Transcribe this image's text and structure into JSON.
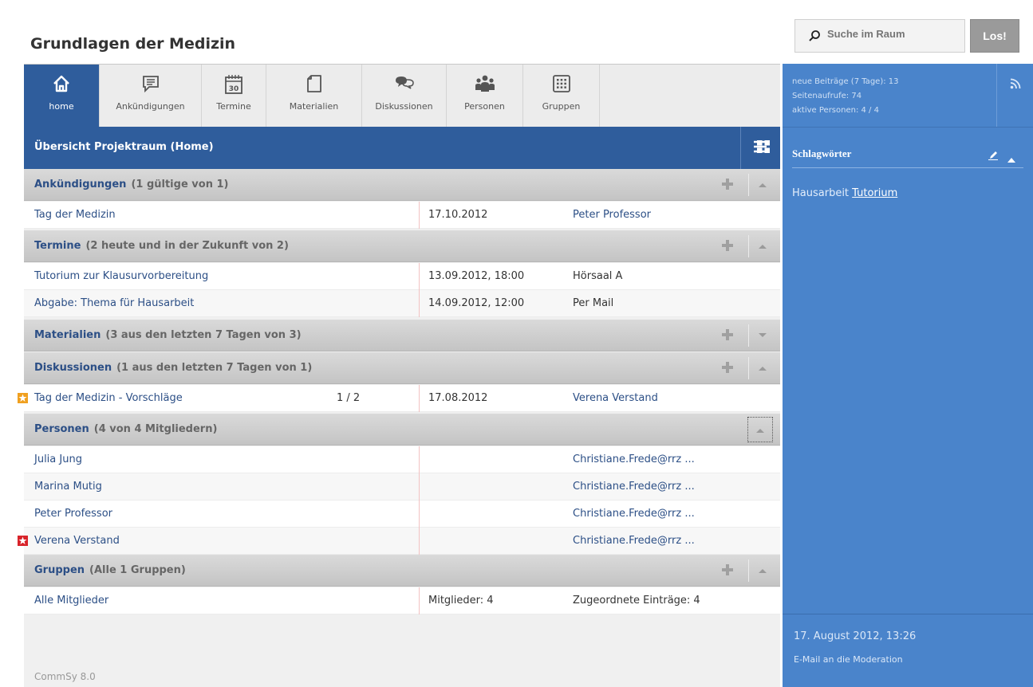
{
  "title": "Grundlagen der Medizin",
  "nav": [
    {
      "label": "home",
      "icon": "home-icon"
    },
    {
      "label": "Ankündigungen",
      "icon": "announcement-icon"
    },
    {
      "label": "Termine",
      "icon": "calendar-icon",
      "icon_text": "30"
    },
    {
      "label": "Materialien",
      "icon": "document-icon"
    },
    {
      "label": "Diskussionen",
      "icon": "discussion-icon"
    },
    {
      "label": "Personen",
      "icon": "people-icon"
    },
    {
      "label": "Gruppen",
      "icon": "groups-grid-icon"
    }
  ],
  "main": {
    "title": "Übersicht Projektraum (Home)",
    "footer": "CommSy 8.0"
  },
  "sections": {
    "ankuendigungen": {
      "title": "Ankündigungen",
      "count": "(1 gültige von 1)"
    },
    "termine": {
      "title": "Termine",
      "count": "(2 heute und in der Zukunft von 2)"
    },
    "materialien": {
      "title": "Materialien",
      "count": "(3 aus den letzten 7 Tagen von 3)"
    },
    "diskussionen": {
      "title": "Diskussionen",
      "count": "(1 aus den letzten 7 Tagen von 1)"
    },
    "personen": {
      "title": "Personen",
      "count": "(4 von 4 Mitgliedern)"
    },
    "gruppen": {
      "title": "Gruppen",
      "count": "(Alle 1 Gruppen)"
    }
  },
  "rows": {
    "ank1": {
      "c1": "Tag der Medizin",
      "c2": "17.10.2012",
      "c3": "Peter Professor"
    },
    "ter1": {
      "c1": "Tutorium zur Klausurvorbereitung",
      "c2": "13.09.2012, 18:00",
      "c3": "Hörsaal A"
    },
    "ter2": {
      "c1": "Abgabe: Thema für Hausarbeit",
      "c2": "14.09.2012, 12:00",
      "c3": "Per Mail"
    },
    "dis1": {
      "c1": "Tag der Medizin - Vorschläge",
      "c1b": "1 / 2",
      "c2": "17.08.2012",
      "c3": "Verena Verstand"
    },
    "per1": {
      "c1": "Julia Jung",
      "c3": "Christiane.Frede@rrz ..."
    },
    "per2": {
      "c1": "Marina Mutig",
      "c3": "Christiane.Frede@rrz ..."
    },
    "per3": {
      "c1": "Peter Professor",
      "c3": "Christiane.Frede@rrz ..."
    },
    "per4": {
      "c1": "Verena Verstand",
      "c3": "Christiane.Frede@rrz ..."
    },
    "gru1": {
      "c1": "Alle Mitglieder",
      "c2": "Mitglieder: 4",
      "c3": "Zugeordnete Einträge: 4"
    }
  },
  "search": {
    "placeholder": "Suche im Raum",
    "button": "Los!"
  },
  "sidebar": {
    "stats": [
      "neue Beiträge (7 Tage): 13",
      "Seitenaufrufe: 74",
      "aktive Personen: 4 / 4"
    ],
    "tags_title": "Schlagwörter",
    "tags": [
      "Hausarbeit",
      "Tutorium"
    ],
    "date": "17. August 2012, 13:26",
    "mail": "E-Mail an die Moderation"
  },
  "colors": {
    "primary": "#2f5d9c",
    "sidebar": "#4a84cb",
    "star_orange": "#f0a020",
    "star_red": "#d8232a"
  }
}
